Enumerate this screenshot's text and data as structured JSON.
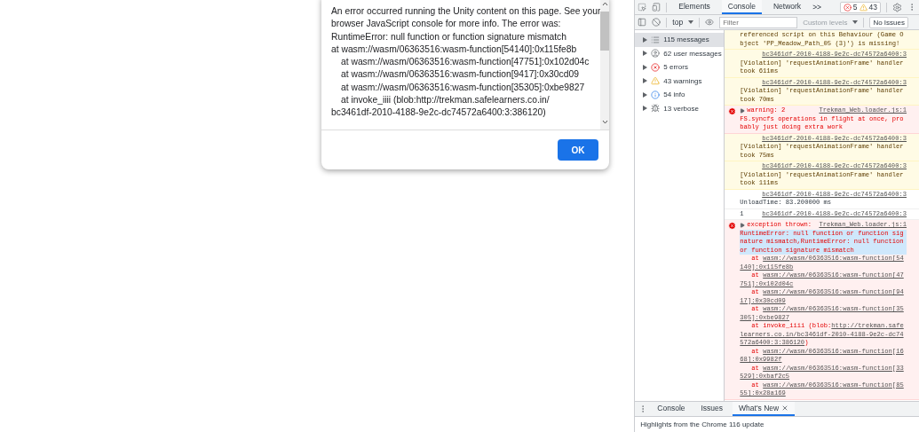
{
  "dialog": {
    "lines": [
      {
        "text": "An error occurred running the Unity content on this page. See your",
        "indented": false
      },
      {
        "text": "browser JavaScript console for more info. The error was:",
        "indented": false
      },
      {
        "text": "RuntimeError: null function or function signature mismatch",
        "indented": false
      },
      {
        "text": "at wasm://wasm/06363516:wasm-function[54140]:0x115fe8b",
        "indented": false
      },
      {
        "text": "at wasm://wasm/06363516:wasm-function[47751]:0x102d04c",
        "indented": true
      },
      {
        "text": "at wasm://wasm/06363516:wasm-function[9417]:0x30cd09",
        "indented": true
      },
      {
        "text": "at wasm://wasm/06363516:wasm-function[35305]:0xbe9827",
        "indented": true
      },
      {
        "text": "at invoke_iiii (blob:http://trekman.safelearners.co.in/",
        "indented": true
      },
      {
        "text": "bc3461df-2010-4188-9e2c-dc74572a6400:3:386120)",
        "indented": false
      }
    ],
    "ok_button": "OK"
  },
  "devtools": {
    "tabs": [
      {
        "label": "Elements",
        "selected": false
      },
      {
        "label": "Console",
        "selected": true
      },
      {
        "label": "Network",
        "selected": false
      }
    ],
    "more_tabs": ">>",
    "error_count": "5",
    "warning_count": "43",
    "context": "top",
    "filter": {
      "placeholder": "Filter"
    },
    "levels": "Custom levels",
    "issues_button": "No Issues",
    "sidebar": [
      {
        "label": "115 messages",
        "kind": "all",
        "selected": true
      },
      {
        "label": "62 user messages",
        "kind": "user",
        "selected": false
      },
      {
        "label": "5 errors",
        "kind": "error",
        "selected": false
      },
      {
        "label": "43 warnings",
        "kind": "warning",
        "selected": false
      },
      {
        "label": "54 info",
        "kind": "info",
        "selected": false
      },
      {
        "label": "13 verbose",
        "kind": "verbose",
        "selected": false
      }
    ],
    "messages": [
      {
        "kind": "warning",
        "text": "referenced script on this Behaviour (Game Object 'PP_Meadow_Path_05 (3)') is missing!"
      },
      {
        "kind": "warning",
        "source": "bc3461df-2010-4188-9e2c-dc74572a6400:3",
        "text": "[Violation] 'requestAnimationFrame' handler took 611ms"
      },
      {
        "kind": "warning",
        "source": "bc3461df-2010-4188-9e2c-dc74572a6400:3",
        "text": "[Violation] 'requestAnimationFrame' handler took 70ms"
      },
      {
        "kind": "error",
        "expandable": true,
        "source": "Trekman_Web.loader.js:1",
        "head": "warning: 2",
        "text": "FS.syncfs operations in flight at once, probably just doing extra work"
      },
      {
        "kind": "warning",
        "source": "bc3461df-2010-4188-9e2c-dc74572a6400:3",
        "text": "[Violation] 'requestAnimationFrame' handler took 75ms"
      },
      {
        "kind": "warning",
        "source": "bc3461df-2010-4188-9e2c-dc74572a6400:3",
        "text": "[Violation] 'requestAnimationFrame' handler took 111ms"
      },
      {
        "kind": "info",
        "source": "bc3461df-2010-4188-9e2c-dc74572a6400:3",
        "text": "UnloadTime: 83.200000 ms"
      },
      {
        "kind": "info",
        "source": "bc3461df-2010-4188-9e2c-dc74572a6400:3",
        "head": "1"
      },
      {
        "kind": "error",
        "expandable": true,
        "source": "Trekman_Web.loader.js:1",
        "head": "exception thrown:",
        "selection": "RuntimeError: null function or function signature mismatch,RuntimeError: null function or function signature mismatch",
        "frames": [
          {
            "before": "at ",
            "link": "wasm://wasm/06363516:wasm-function[54140]:0x115fe8b"
          },
          {
            "before": "at ",
            "link": "wasm://wasm/06363516:wasm-function[47751]:0x102d04c"
          },
          {
            "before": "at ",
            "link": "wasm://wasm/06363516:wasm-function[9417]:0x30cd09"
          },
          {
            "before": "at ",
            "link": "wasm://wasm/06363516:wasm-function[35305]:0xbe9827"
          },
          {
            "before": "at invoke_iiii (blob:",
            "link": "http://trekman.safelearners.co.in/bc3461df-2010-4188-9e2c-dc74572a6400:3:386120",
            "after": ")"
          },
          {
            "before": "at ",
            "link": "wasm://wasm/06363516:wasm-function[1668]:0x9982f"
          },
          {
            "before": "at ",
            "link": "wasm://wasm/06363516:wasm-function[33529]:0xbaf2c5"
          },
          {
            "before": "at ",
            "link": "wasm://wasm/06363516:wasm-function[8555]:0x28a169"
          }
        ]
      }
    ],
    "drawer": {
      "tabs": [
        {
          "label": "Console",
          "selected": false
        },
        {
          "label": "Issues",
          "selected": false
        },
        {
          "label": "What's New",
          "selected": true,
          "closable": true
        }
      ],
      "text": "Highlights from the Chrome 116 update"
    }
  }
}
